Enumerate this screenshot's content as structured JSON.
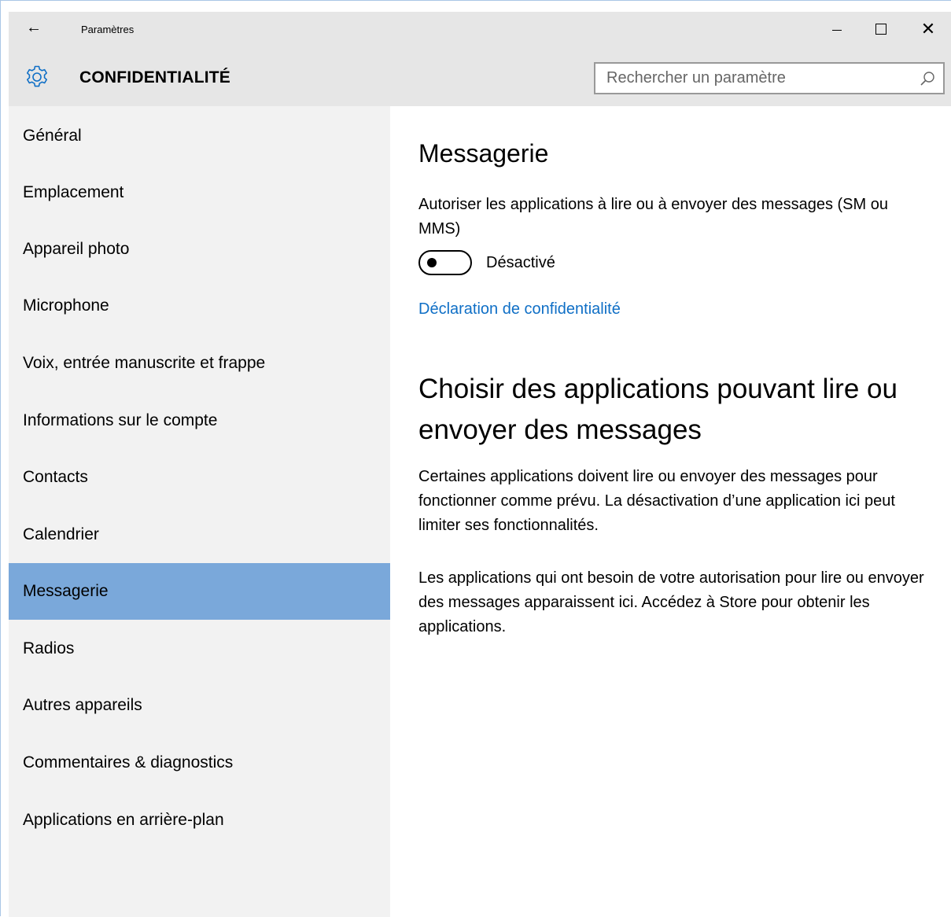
{
  "window": {
    "back_glyph": "←",
    "title": "Paramètres"
  },
  "header": {
    "icon": "gear-icon",
    "title": "CONFIDENTIALITÉ",
    "search_placeholder": "Rechercher un paramètre",
    "search_icon": "search-icon"
  },
  "sidebar": {
    "items": [
      {
        "label": "Général"
      },
      {
        "label": "Emplacement"
      },
      {
        "label": "Appareil photo"
      },
      {
        "label": "Microphone"
      },
      {
        "label": "Voix, entrée manuscrite et frappe"
      },
      {
        "label": "Informations sur le compte"
      },
      {
        "label": "Contacts"
      },
      {
        "label": "Calendrier"
      },
      {
        "label": "Messagerie"
      },
      {
        "label": "Radios"
      },
      {
        "label": "Autres appareils"
      },
      {
        "label": "Commentaires & diagnostics"
      },
      {
        "label": "Applications en arrière-plan"
      }
    ],
    "selected_label": "Messagerie"
  },
  "main": {
    "title": "Messagerie",
    "description": "Autoriser les applications à lire ou à envoyer des messages (SM ou MMS)",
    "toggle_state": "off",
    "toggle_label": "Désactivé",
    "privacy_link": "Déclaration de confidentialité",
    "section_title": "Choisir des applications pouvant lire ou envoyer des messages",
    "paragraph1": "Certaines applications doivent lire ou envoyer des messages pour fonctionner comme prévu. La désactivation d’une application ici peut limiter ses fonctionnalités.",
    "paragraph2": "Les applications qui ont besoin de votre autorisation pour lire ou envoyer des messages apparaissent ici. Accédez à Store pour obtenir les applications."
  },
  "colors": {
    "accent": "#7aa8da",
    "link": "#0f6fc6",
    "header_bg": "#e6e6e6",
    "sidebar_bg": "#f2f2f2"
  }
}
